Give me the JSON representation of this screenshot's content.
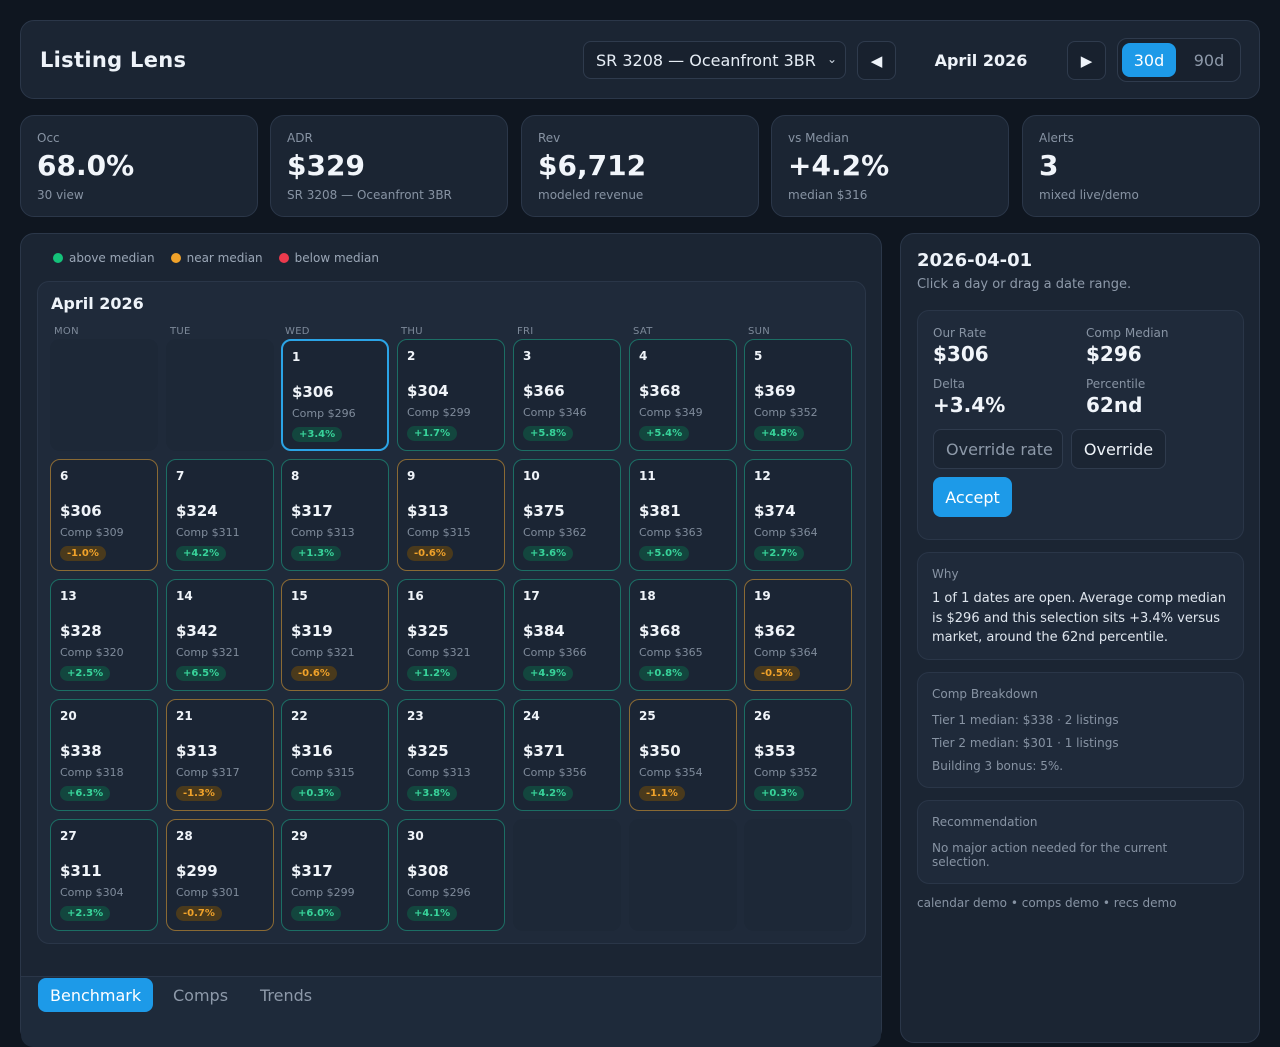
{
  "header": {
    "app_title": "Listing Lens",
    "listing_select": "SR 3208 — Oceanfront 3BR",
    "prev_icon": "◀",
    "next_icon": "▶",
    "month_label": "April 2026",
    "range_options": [
      "30d",
      "90d"
    ],
    "range_selected": "30d"
  },
  "kpis": [
    {
      "label": "Occ",
      "value": "68.0%",
      "sub": "30 view"
    },
    {
      "label": "ADR",
      "value": "$329",
      "sub": "SR 3208 — Oceanfront 3BR"
    },
    {
      "label": "Rev",
      "value": "$6,712",
      "sub": "modeled revenue"
    },
    {
      "label": "vs Median",
      "value": "+4.2%",
      "sub": "median $316"
    },
    {
      "label": "Alerts",
      "value": "3",
      "sub": "mixed live/demo"
    }
  ],
  "legend": [
    "above median",
    "near median",
    "below median"
  ],
  "colors": {
    "above": "#14c27a",
    "near": "#f0a22a",
    "below": "#ec3a4d",
    "accent": "#1d9ae8"
  },
  "calendar": {
    "title": "April 2026",
    "weekdays": [
      "MON",
      "TUE",
      "WED",
      "THU",
      "FRI",
      "SAT",
      "SUN"
    ],
    "leading_blanks": 2,
    "selected_day": 1,
    "days": [
      {
        "day": "1",
        "rate": "$306",
        "comp": "Comp $296",
        "delta": "+3.4%",
        "status": "above"
      },
      {
        "day": "2",
        "rate": "$304",
        "comp": "Comp $299",
        "delta": "+1.7%",
        "status": "above"
      },
      {
        "day": "3",
        "rate": "$366",
        "comp": "Comp $346",
        "delta": "+5.8%",
        "status": "above"
      },
      {
        "day": "4",
        "rate": "$368",
        "comp": "Comp $349",
        "delta": "+5.4%",
        "status": "above"
      },
      {
        "day": "5",
        "rate": "$369",
        "comp": "Comp $352",
        "delta": "+4.8%",
        "status": "above"
      },
      {
        "day": "6",
        "rate": "$306",
        "comp": "Comp $309",
        "delta": "-1.0%",
        "status": "near"
      },
      {
        "day": "7",
        "rate": "$324",
        "comp": "Comp $311",
        "delta": "+4.2%",
        "status": "above"
      },
      {
        "day": "8",
        "rate": "$317",
        "comp": "Comp $313",
        "delta": "+1.3%",
        "status": "above"
      },
      {
        "day": "9",
        "rate": "$313",
        "comp": "Comp $315",
        "delta": "-0.6%",
        "status": "near"
      },
      {
        "day": "10",
        "rate": "$375",
        "comp": "Comp $362",
        "delta": "+3.6%",
        "status": "above"
      },
      {
        "day": "11",
        "rate": "$381",
        "comp": "Comp $363",
        "delta": "+5.0%",
        "status": "above"
      },
      {
        "day": "12",
        "rate": "$374",
        "comp": "Comp $364",
        "delta": "+2.7%",
        "status": "above"
      },
      {
        "day": "13",
        "rate": "$328",
        "comp": "Comp $320",
        "delta": "+2.5%",
        "status": "above"
      },
      {
        "day": "14",
        "rate": "$342",
        "comp": "Comp $321",
        "delta": "+6.5%",
        "status": "above"
      },
      {
        "day": "15",
        "rate": "$319",
        "comp": "Comp $321",
        "delta": "-0.6%",
        "status": "near"
      },
      {
        "day": "16",
        "rate": "$325",
        "comp": "Comp $321",
        "delta": "+1.2%",
        "status": "above"
      },
      {
        "day": "17",
        "rate": "$384",
        "comp": "Comp $366",
        "delta": "+4.9%",
        "status": "above"
      },
      {
        "day": "18",
        "rate": "$368",
        "comp": "Comp $365",
        "delta": "+0.8%",
        "status": "above"
      },
      {
        "day": "19",
        "rate": "$362",
        "comp": "Comp $364",
        "delta": "-0.5%",
        "status": "near"
      },
      {
        "day": "20",
        "rate": "$338",
        "comp": "Comp $318",
        "delta": "+6.3%",
        "status": "above"
      },
      {
        "day": "21",
        "rate": "$313",
        "comp": "Comp $317",
        "delta": "-1.3%",
        "status": "near"
      },
      {
        "day": "22",
        "rate": "$316",
        "comp": "Comp $315",
        "delta": "+0.3%",
        "status": "above"
      },
      {
        "day": "23",
        "rate": "$325",
        "comp": "Comp $313",
        "delta": "+3.8%",
        "status": "above"
      },
      {
        "day": "24",
        "rate": "$371",
        "comp": "Comp $356",
        "delta": "+4.2%",
        "status": "above"
      },
      {
        "day": "25",
        "rate": "$350",
        "comp": "Comp $354",
        "delta": "-1.1%",
        "status": "near"
      },
      {
        "day": "26",
        "rate": "$353",
        "comp": "Comp $352",
        "delta": "+0.3%",
        "status": "above"
      },
      {
        "day": "27",
        "rate": "$311",
        "comp": "Comp $304",
        "delta": "+2.3%",
        "status": "above"
      },
      {
        "day": "28",
        "rate": "$299",
        "comp": "Comp $301",
        "delta": "-0.7%",
        "status": "near"
      },
      {
        "day": "29",
        "rate": "$317",
        "comp": "Comp $299",
        "delta": "+6.0%",
        "status": "above"
      },
      {
        "day": "30",
        "rate": "$308",
        "comp": "Comp $296",
        "delta": "+4.1%",
        "status": "above"
      }
    ]
  },
  "tabs": [
    {
      "label": "Benchmark",
      "active": true
    },
    {
      "label": "Comps",
      "active": false
    },
    {
      "label": "Trends",
      "active": false
    }
  ],
  "detail": {
    "date": "2026-04-01",
    "hint": "Click a day or drag a date range.",
    "our_rate_label": "Our Rate",
    "our_rate": "$306",
    "comp_median_label": "Comp Median",
    "comp_median": "$296",
    "delta_label": "Delta",
    "delta": "+3.4%",
    "percentile_label": "Percentile",
    "percentile": "62nd",
    "override_placeholder": "Override rate",
    "override_button": "Override",
    "accept_button": "Accept",
    "why_title": "Why",
    "why_body": "1 of 1 dates are open. Average comp median is $296 and this selection sits +3.4% versus market, around the 62nd percentile.",
    "breakdown_title": "Comp Breakdown",
    "breakdown_lines": [
      "Tier 1 median: $338 · 2 listings",
      "Tier 2 median: $301 · 1 listings",
      "Building 3 bonus: 5%."
    ],
    "rec_title": "Recommendation",
    "rec_body": "No major action needed for the current selection.",
    "footer": "calendar demo • comps demo • recs demo"
  }
}
